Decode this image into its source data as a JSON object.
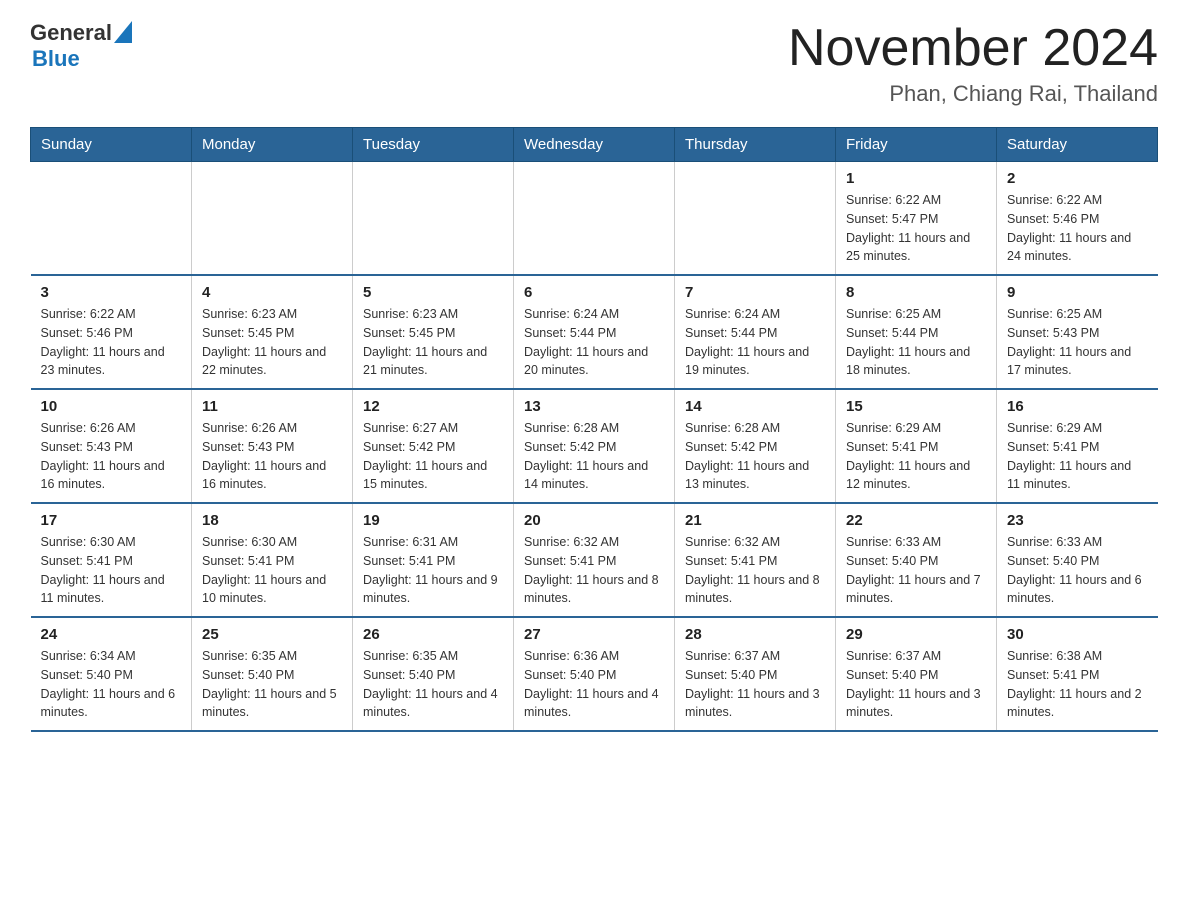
{
  "header": {
    "logo_general": "General",
    "logo_blue": "Blue",
    "month_title": "November 2024",
    "location": "Phan, Chiang Rai, Thailand"
  },
  "days_of_week": [
    "Sunday",
    "Monday",
    "Tuesday",
    "Wednesday",
    "Thursday",
    "Friday",
    "Saturday"
  ],
  "weeks": [
    [
      {
        "day": "",
        "info": ""
      },
      {
        "day": "",
        "info": ""
      },
      {
        "day": "",
        "info": ""
      },
      {
        "day": "",
        "info": ""
      },
      {
        "day": "",
        "info": ""
      },
      {
        "day": "1",
        "info": "Sunrise: 6:22 AM\nSunset: 5:47 PM\nDaylight: 11 hours and 25 minutes."
      },
      {
        "day": "2",
        "info": "Sunrise: 6:22 AM\nSunset: 5:46 PM\nDaylight: 11 hours and 24 minutes."
      }
    ],
    [
      {
        "day": "3",
        "info": "Sunrise: 6:22 AM\nSunset: 5:46 PM\nDaylight: 11 hours and 23 minutes."
      },
      {
        "day": "4",
        "info": "Sunrise: 6:23 AM\nSunset: 5:45 PM\nDaylight: 11 hours and 22 minutes."
      },
      {
        "day": "5",
        "info": "Sunrise: 6:23 AM\nSunset: 5:45 PM\nDaylight: 11 hours and 21 minutes."
      },
      {
        "day": "6",
        "info": "Sunrise: 6:24 AM\nSunset: 5:44 PM\nDaylight: 11 hours and 20 minutes."
      },
      {
        "day": "7",
        "info": "Sunrise: 6:24 AM\nSunset: 5:44 PM\nDaylight: 11 hours and 19 minutes."
      },
      {
        "day": "8",
        "info": "Sunrise: 6:25 AM\nSunset: 5:44 PM\nDaylight: 11 hours and 18 minutes."
      },
      {
        "day": "9",
        "info": "Sunrise: 6:25 AM\nSunset: 5:43 PM\nDaylight: 11 hours and 17 minutes."
      }
    ],
    [
      {
        "day": "10",
        "info": "Sunrise: 6:26 AM\nSunset: 5:43 PM\nDaylight: 11 hours and 16 minutes."
      },
      {
        "day": "11",
        "info": "Sunrise: 6:26 AM\nSunset: 5:43 PM\nDaylight: 11 hours and 16 minutes."
      },
      {
        "day": "12",
        "info": "Sunrise: 6:27 AM\nSunset: 5:42 PM\nDaylight: 11 hours and 15 minutes."
      },
      {
        "day": "13",
        "info": "Sunrise: 6:28 AM\nSunset: 5:42 PM\nDaylight: 11 hours and 14 minutes."
      },
      {
        "day": "14",
        "info": "Sunrise: 6:28 AM\nSunset: 5:42 PM\nDaylight: 11 hours and 13 minutes."
      },
      {
        "day": "15",
        "info": "Sunrise: 6:29 AM\nSunset: 5:41 PM\nDaylight: 11 hours and 12 minutes."
      },
      {
        "day": "16",
        "info": "Sunrise: 6:29 AM\nSunset: 5:41 PM\nDaylight: 11 hours and 11 minutes."
      }
    ],
    [
      {
        "day": "17",
        "info": "Sunrise: 6:30 AM\nSunset: 5:41 PM\nDaylight: 11 hours and 11 minutes."
      },
      {
        "day": "18",
        "info": "Sunrise: 6:30 AM\nSunset: 5:41 PM\nDaylight: 11 hours and 10 minutes."
      },
      {
        "day": "19",
        "info": "Sunrise: 6:31 AM\nSunset: 5:41 PM\nDaylight: 11 hours and 9 minutes."
      },
      {
        "day": "20",
        "info": "Sunrise: 6:32 AM\nSunset: 5:41 PM\nDaylight: 11 hours and 8 minutes."
      },
      {
        "day": "21",
        "info": "Sunrise: 6:32 AM\nSunset: 5:41 PM\nDaylight: 11 hours and 8 minutes."
      },
      {
        "day": "22",
        "info": "Sunrise: 6:33 AM\nSunset: 5:40 PM\nDaylight: 11 hours and 7 minutes."
      },
      {
        "day": "23",
        "info": "Sunrise: 6:33 AM\nSunset: 5:40 PM\nDaylight: 11 hours and 6 minutes."
      }
    ],
    [
      {
        "day": "24",
        "info": "Sunrise: 6:34 AM\nSunset: 5:40 PM\nDaylight: 11 hours and 6 minutes."
      },
      {
        "day": "25",
        "info": "Sunrise: 6:35 AM\nSunset: 5:40 PM\nDaylight: 11 hours and 5 minutes."
      },
      {
        "day": "26",
        "info": "Sunrise: 6:35 AM\nSunset: 5:40 PM\nDaylight: 11 hours and 4 minutes."
      },
      {
        "day": "27",
        "info": "Sunrise: 6:36 AM\nSunset: 5:40 PM\nDaylight: 11 hours and 4 minutes."
      },
      {
        "day": "28",
        "info": "Sunrise: 6:37 AM\nSunset: 5:40 PM\nDaylight: 11 hours and 3 minutes."
      },
      {
        "day": "29",
        "info": "Sunrise: 6:37 AM\nSunset: 5:40 PM\nDaylight: 11 hours and 3 minutes."
      },
      {
        "day": "30",
        "info": "Sunrise: 6:38 AM\nSunset: 5:41 PM\nDaylight: 11 hours and 2 minutes."
      }
    ]
  ]
}
